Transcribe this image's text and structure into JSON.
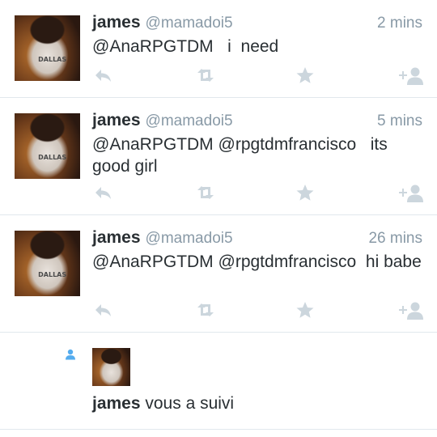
{
  "tweets": [
    {
      "name": "james",
      "handle": "@mamadoi5",
      "time": "2 mins",
      "text": "@AnaRPGTDM   i  need",
      "avatar_jersey": "DALLAS"
    },
    {
      "name": "james",
      "handle": "@mamadoi5",
      "time": "5 mins",
      "text": "@AnaRPGTDM @rpgtdmfrancisco   its good girl",
      "avatar_jersey": "DALLAS"
    },
    {
      "name": "james",
      "handle": "@mamadoi5",
      "time": "26 mins",
      "text": "@AnaRPGTDM @rpgtdmfrancisco  hi babe",
      "avatar_jersey": "DALLAS"
    }
  ],
  "follow": {
    "name": "james",
    "action": " vous a suivi"
  },
  "icons": {
    "reply": "reply-icon",
    "retweet": "retweet-icon",
    "favorite": "star-icon",
    "follow": "add-user-icon",
    "follow_notification": "person-icon"
  },
  "colors": {
    "text": "#292f33",
    "muted": "#8899a6",
    "icon": "#ccd6dd",
    "divider": "#e1e8ed",
    "accent": "#55acee"
  }
}
